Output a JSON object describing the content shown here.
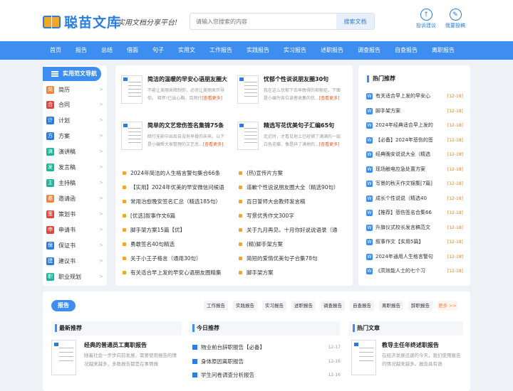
{
  "brand": {
    "name": "聪苗文库",
    "slogan": "实用文档分享平台!"
  },
  "search": {
    "placeholder": "请输入您搜索的内容",
    "button": "搜索文档"
  },
  "header_actions": [
    {
      "label": "投诉建议",
      "icon": "upload-icon"
    },
    {
      "label": "我要投稿",
      "icon": "pen-icon"
    }
  ],
  "nav": [
    "首页",
    "报告",
    "总结",
    "借面",
    "句子",
    "实用文",
    "工作报告",
    "实践报告",
    "实习报告",
    "述职报告",
    "调查报告",
    "自查报告",
    "离职报告"
  ],
  "sidebar": {
    "title": "实用范文导航",
    "items": [
      {
        "label": "简历",
        "glyph": "简",
        "color": "#f0853a"
      },
      {
        "label": "合同",
        "glyph": "合",
        "color": "#e8443a"
      },
      {
        "label": "计划",
        "glyph": "计",
        "color": "#2a7de1"
      },
      {
        "label": "方案",
        "glyph": "方",
        "color": "#2a7de1"
      },
      {
        "label": "演讲稿",
        "glyph": "演",
        "color": "#1bb59a"
      },
      {
        "label": "发言稿",
        "glyph": "发",
        "color": "#1bb59a"
      },
      {
        "label": "主持稿",
        "glyph": "主",
        "color": "#1bb59a"
      },
      {
        "label": "邀请函",
        "glyph": "邀",
        "color": "#f0853a"
      },
      {
        "label": "策划书",
        "glyph": "策",
        "color": "#e8443a"
      },
      {
        "label": "申请书",
        "glyph": "申",
        "color": "#e8443a"
      },
      {
        "label": "保证书",
        "glyph": "保",
        "color": "#2a7de1"
      },
      {
        "label": "建议书",
        "glyph": "建",
        "color": "#2a7de1"
      },
      {
        "label": "职业规划",
        "glyph": "职",
        "color": "#1bb59a"
      }
    ],
    "arrow": ">"
  },
  "featured": [
    {
      "title": "简洁的温暖的早安心语朋友圈大",
      "desc": "不能让美丽来障制你，必须让美丽来开导你。 释怀!已出心胸，百则什",
      "more": "[查看更多]"
    },
    {
      "title": "忧郁个性说说朋友圈30句",
      "desc": "我在这么忧郁下去早晚得的抑郁症。下面是小编为各位读者收集的忧...",
      "more": "[查看更多]"
    },
    {
      "title": "简单的文艺悲伤签名集锦75条",
      "desc": "暗行无影中出现自没有早餐的未来。以下是小编帮大家整理的文艺悲...",
      "more": "[查看更多]"
    },
    {
      "title": "精选写花优美句子汇编65句",
      "desc": "走近时，才看见地上已经铺了满满的一层白色花瓣。像是碎了满地的...",
      "more": "[查看更多]"
    }
  ],
  "articles": [
    "2024年简洁的人生格言警句集合66条",
    "(热)宣传片方案",
    "【实用】2024年优美的早安微信问候语",
    "道歉个性说说朋友圈大全（精选90句）",
    "常用治愈晚安签名汇总（精选185句）",
    "百日誓师大会教师发言稿",
    "[优选]叙事作文6篇",
    "写景优秀作文300字",
    "脚手架方案15篇【优】",
    "关于九月再见，十月你好说说语录（通",
    "勇敢签名40句精选",
    "(精)脚手架方案",
    "关于小王子格言（通用30句）",
    "简短的爱情优美句子合集78句",
    "有关适合早上发的早安心语朋友圈精集",
    "脚手架方案"
  ],
  "hot": {
    "title": "热门推荐",
    "items": [
      {
        "t": "有关适合早上发的早安心",
        "d": "[12-18]"
      },
      {
        "t": "脚手架方案",
        "d": "[12-18]"
      },
      {
        "t": "2024年经典适合早上发的",
        "d": "[12-18]"
      },
      {
        "t": "【必备】2024年悲伤的签",
        "d": "[12-18]"
      },
      {
        "t": "经典晚安说说大全（精选",
        "d": "[12-18]"
      },
      {
        "t": "现场触电应急处置方案",
        "d": "[12-18]"
      },
      {
        "t": "写景的秋天作文锦集[7篇]",
        "d": "[12-18]"
      },
      {
        "t": "成长个性说说（精选40",
        "d": "[12-18]"
      },
      {
        "t": "【推荐】悲伤签名合集66",
        "d": "[12-18]"
      },
      {
        "t": "升旗仪式校长发言稿范文",
        "d": "[12-18]"
      },
      {
        "t": "叙事作文【实用5篇】",
        "d": "[12-18]"
      },
      {
        "t": "2024年通用人生格言警句",
        "d": "[12-18]"
      },
      {
        "t": "《高效能人士的七个习",
        "d": "[12-18]"
      }
    ]
  },
  "report": {
    "tag": "报告",
    "tabs": [
      "工作报告",
      "实践报告",
      "实习报告",
      "述职报告",
      "调查报告",
      "自查报告",
      "离职报告",
      "辞职报告",
      "更多 >>"
    ],
    "latest": {
      "title": "最新推荐",
      "doc_title": "经典的普通员工离职报告",
      "desc": "随着社会一步步向前发展，需要使用报告的情况越来越多，多数报告都是在事情做"
    },
    "today": {
      "title": "今日推荐",
      "items": [
        {
          "t": "物业前台辞职报告【必备】",
          "d": "12-17"
        },
        {
          "t": "身体原因离职报告",
          "d": "12-16"
        },
        {
          "t": "学生问卷调查分析报告",
          "d": "12-16"
        }
      ]
    },
    "hotdoc": {
      "title": "热门文章",
      "doc_title": "教导主任年终述职报告",
      "desc": "在经济发展迅速的今天，我们使用报告的情况越来越多，报告具有语"
    }
  }
}
